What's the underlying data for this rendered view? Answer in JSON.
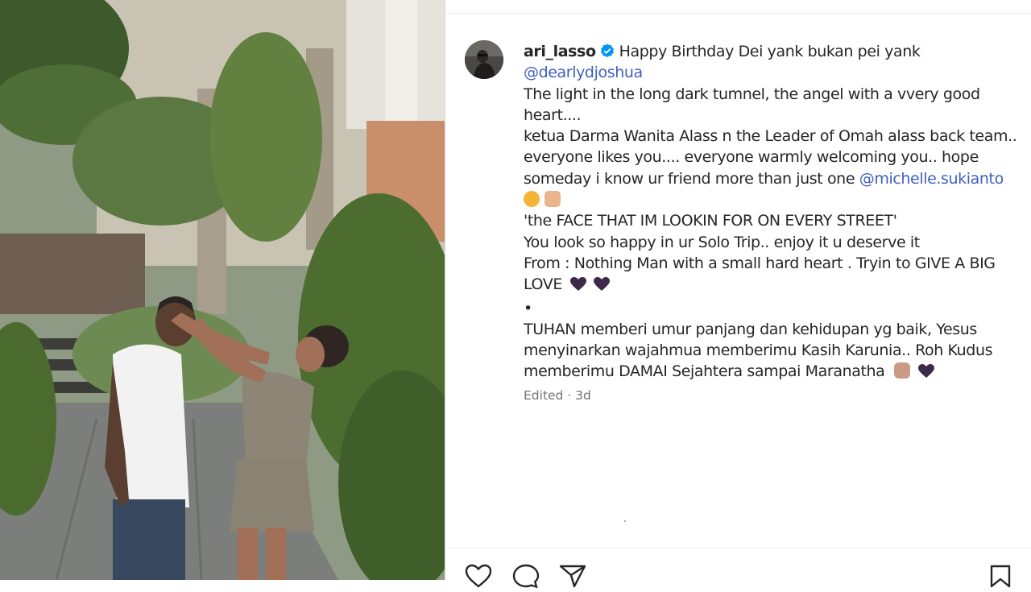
{
  "post": {
    "username": "ari_lasso",
    "caption_lines": [
      "Happy Birthday Dei yank bukan pei yank",
      "@dearlydjoshua",
      "The light in the long dark tumnel, the angel with a vvery good",
      "heart....",
      "ketua Darma Wanita Alass n the Leader of Omah alass back team..",
      "everyone likes you.... everyone warmly welcoming you.. hope",
      "someday i know ur friend more than just one ",
      "@michelle.sukianto",
      "'the FACE THAT IM LOOKIN FOR ON EVERY STREET'",
      "You look so happy in ur Solo Trip.. enjoy it u deserve it",
      "From : Nothing Man with a small hard heart . Tryin to GIVE A BIG",
      "LOVE",
      "•",
      "TUHAN memberi umur panjang dan kehidupan yg baik, Yesus",
      "menyinarkan wajahmua memberimu Kasih Karunia.. Roh Kudus",
      "memberimu DAMAI Sejahtera sampai Maranatha"
    ],
    "meta": "Edited · 3d"
  },
  "icons": {
    "verified": "verified-badge-icon",
    "like": "heart-outline-icon",
    "comment": "comment-bubble-icon",
    "share": "paper-plane-icon",
    "save": "bookmark-icon"
  },
  "colors": {
    "mention": "#3f5fbf",
    "verified": "#0095f6",
    "text": "#262626",
    "meta": "#737373"
  }
}
